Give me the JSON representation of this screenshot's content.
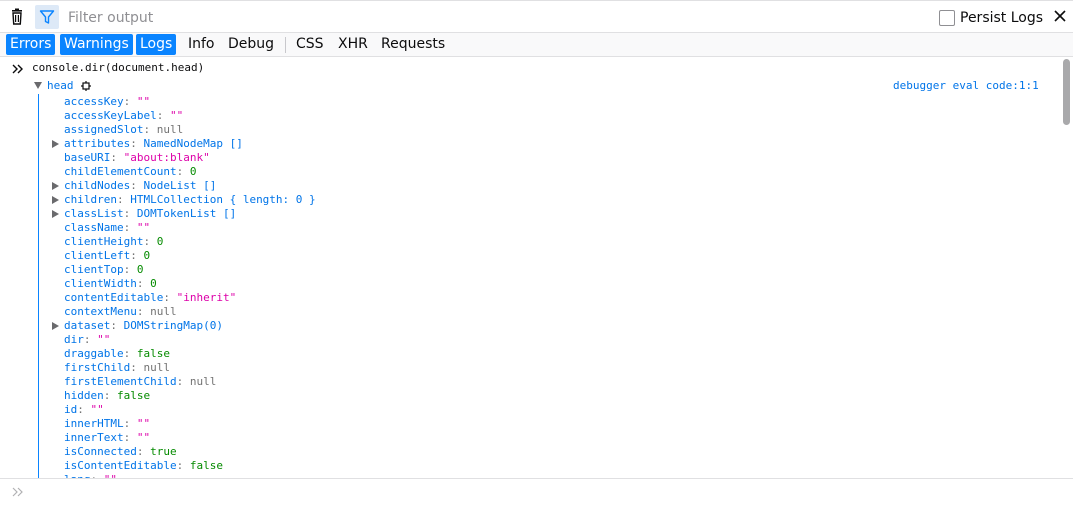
{
  "toolbar": {
    "filter_placeholder": "Filter output",
    "persist_logs_label": "Persist Logs"
  },
  "filters": {
    "errors": "Errors",
    "warnings": "Warnings",
    "logs": "Logs",
    "info": "Info",
    "debug": "Debug",
    "css": "CSS",
    "xhr": "XHR",
    "requests": "Requests"
  },
  "console": {
    "command": "console.dir(document.head)",
    "object_name": "head",
    "source_link": "debugger eval code:1:1",
    "properties": [
      {
        "key": "accessKey",
        "value": "\"\"",
        "type": "string",
        "expandable": false
      },
      {
        "key": "accessKeyLabel",
        "value": "\"\"",
        "type": "string",
        "expandable": false
      },
      {
        "key": "assignedSlot",
        "value": "null",
        "type": "null",
        "expandable": false
      },
      {
        "key": "attributes",
        "value": "NamedNodeMap []",
        "type": "object",
        "expandable": true
      },
      {
        "key": "baseURI",
        "value": "\"about:blank\"",
        "type": "string",
        "expandable": false
      },
      {
        "key": "childElementCount",
        "value": "0",
        "type": "number",
        "expandable": false
      },
      {
        "key": "childNodes",
        "value": "NodeList []",
        "type": "object",
        "expandable": true
      },
      {
        "key": "children",
        "value": "HTMLCollection { length: 0 }",
        "type": "object",
        "expandable": true
      },
      {
        "key": "classList",
        "value": "DOMTokenList []",
        "type": "object",
        "expandable": true
      },
      {
        "key": "className",
        "value": "\"\"",
        "type": "string",
        "expandable": false
      },
      {
        "key": "clientHeight",
        "value": "0",
        "type": "number",
        "expandable": false
      },
      {
        "key": "clientLeft",
        "value": "0",
        "type": "number",
        "expandable": false
      },
      {
        "key": "clientTop",
        "value": "0",
        "type": "number",
        "expandable": false
      },
      {
        "key": "clientWidth",
        "value": "0",
        "type": "number",
        "expandable": false
      },
      {
        "key": "contentEditable",
        "value": "\"inherit\"",
        "type": "string",
        "expandable": false
      },
      {
        "key": "contextMenu",
        "value": "null",
        "type": "null",
        "expandable": false
      },
      {
        "key": "dataset",
        "value": "DOMStringMap(0)",
        "type": "object",
        "expandable": true
      },
      {
        "key": "dir",
        "value": "\"\"",
        "type": "string",
        "expandable": false
      },
      {
        "key": "draggable",
        "value": "false",
        "type": "bool",
        "expandable": false
      },
      {
        "key": "firstChild",
        "value": "null",
        "type": "null",
        "expandable": false
      },
      {
        "key": "firstElementChild",
        "value": "null",
        "type": "null",
        "expandable": false
      },
      {
        "key": "hidden",
        "value": "false",
        "type": "bool",
        "expandable": false
      },
      {
        "key": "id",
        "value": "\"\"",
        "type": "string",
        "expandable": false
      },
      {
        "key": "innerHTML",
        "value": "\"\"",
        "type": "string",
        "expandable": false
      },
      {
        "key": "innerText",
        "value": "\"\"",
        "type": "string",
        "expandable": false
      },
      {
        "key": "isConnected",
        "value": "true",
        "type": "bool",
        "expandable": false
      },
      {
        "key": "isContentEditable",
        "value": "false",
        "type": "bool",
        "expandable": false
      },
      {
        "key": "lang",
        "value": "\"\"",
        "type": "string",
        "expandable": false
      }
    ]
  },
  "colors": {
    "accent": "#0a84ff",
    "key": "#0074e8",
    "string": "#dd00a9",
    "number": "#058b00",
    "null": "#737373"
  }
}
